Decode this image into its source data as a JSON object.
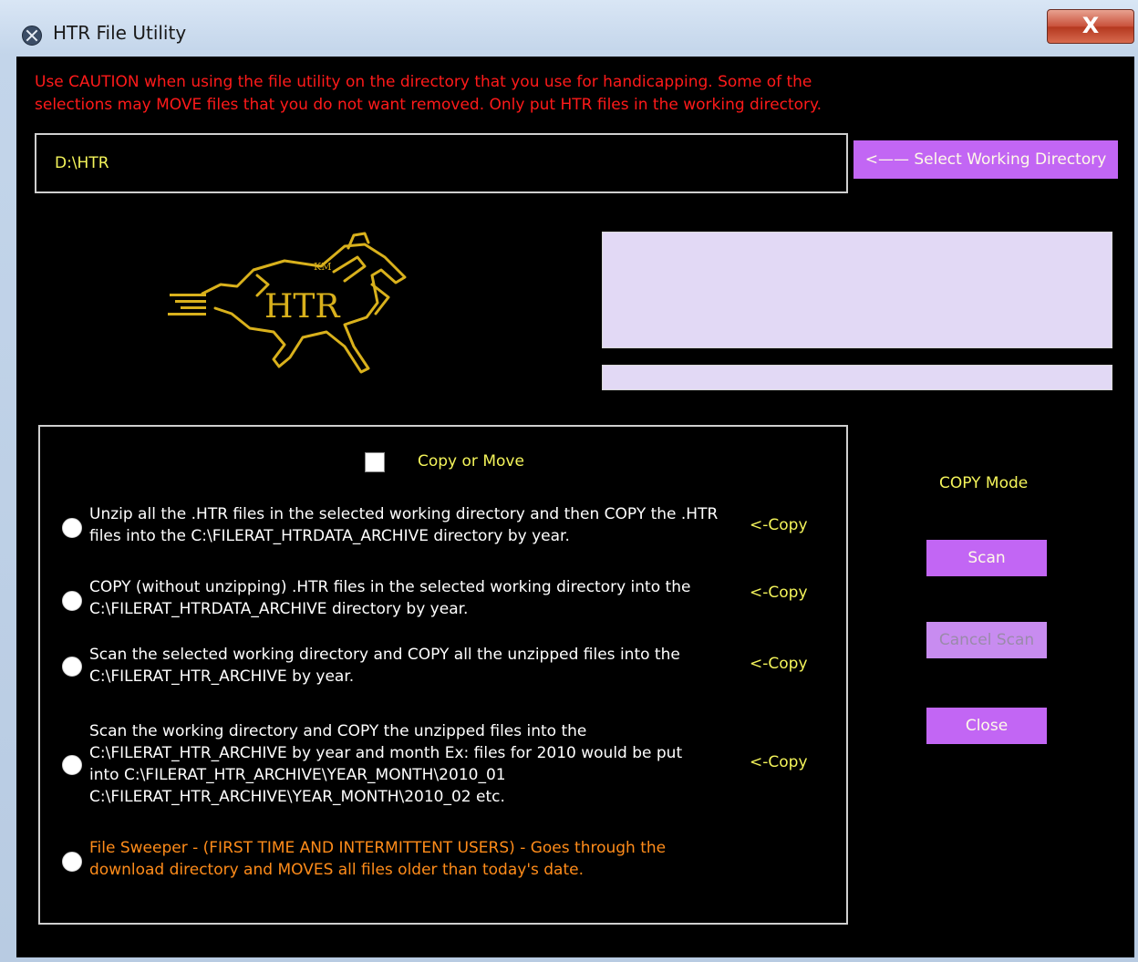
{
  "window": {
    "title": "HTR File Utility",
    "close_glyph": "X"
  },
  "warning": "Use CAUTION when using the file utility on the directory that you use for handicapping. Some of the selections may MOVE files that you do not want removed. Only put HTR files in the working directory.",
  "directory": {
    "value": "D:\\HTR",
    "select_button_label": "<—— Select Working Directory"
  },
  "logo": {
    "text": "HTR",
    "monogram": "KM"
  },
  "options": {
    "checkbox_label": "Copy or Move",
    "checkbox_checked": false,
    "items": [
      {
        "text": "Unzip all the .HTR files in the selected working directory and then COPY the .HTR files into the C:\\FILERAT_HTRDATA_ARCHIVE directory by year.",
        "tag": "<-Copy"
      },
      {
        "text": "COPY (without unzipping) .HTR files in the selected working directory into the C:\\FILERAT_HTRDATA_ARCHIVE directory by year.",
        "tag": "<-Copy"
      },
      {
        "text": "Scan the selected working directory and COPY all the unzipped files into the C:\\FILERAT_HTR_ARCHIVE by year.",
        "tag": "<-Copy"
      },
      {
        "text": "Scan the working directory and COPY the unzipped files into the C:\\FILERAT_HTR_ARCHIVE by year and month  Ex: files for 2010 would be put into C:\\FILERAT_HTR_ARCHIVE\\YEAR_MONTH\\2010_01 C:\\FILERAT_HTR_ARCHIVE\\YEAR_MONTH\\2010_02 etc.",
        "tag": "<-Copy"
      },
      {
        "text": "File Sweeper - (FIRST TIME AND INTERMITTENT USERS) - Goes through  the download directory and MOVES all files older than today's date.",
        "tag": ""
      }
    ]
  },
  "mode_label": "COPY Mode",
  "buttons": {
    "scan": "Scan",
    "cancel_scan": "Cancel Scan",
    "close": "Close"
  },
  "colors": {
    "accent": "#c266f4",
    "warning": "#ff1a1a",
    "label_yellow": "#f4f45a",
    "sweeper_orange": "#ff8c1a",
    "panel": "#e2d9f5"
  }
}
